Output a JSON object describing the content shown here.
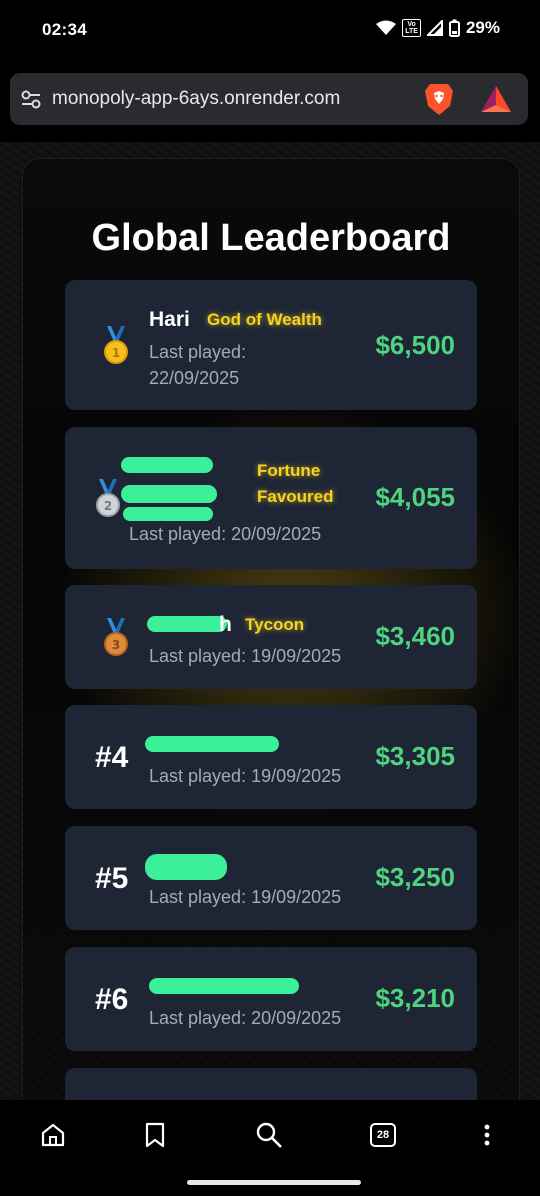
{
  "status": {
    "time": "02:34",
    "battery": "29%"
  },
  "browser": {
    "url": "monopoly-app-6ays.onrender.com"
  },
  "page": {
    "title": "Global Leaderboard"
  },
  "leaderboard": [
    {
      "rank_label": "",
      "medal": "gold-medal-icon",
      "name": "Hari",
      "badge": "God of Wealth",
      "played_label": "Last played:",
      "played_date": "22/09/2025",
      "amount": "$6,500"
    },
    {
      "rank_label": "",
      "medal": "silver-medal-icon",
      "name": "",
      "badge_line1": "Fortune",
      "badge_line2": "Favoured",
      "played": "Last played: 20/09/2025",
      "amount": "$4,055"
    },
    {
      "rank_label": "",
      "medal": "bronze-medal-icon",
      "name": "h",
      "badge": "Tycoon",
      "played": "Last played: 19/09/2025",
      "amount": "$3,460"
    },
    {
      "rank_label": "#4",
      "name": "",
      "played": "Last played: 19/09/2025",
      "amount": "$3,305"
    },
    {
      "rank_label": "#5",
      "name": "",
      "played": "Last played: 19/09/2025",
      "amount": "$3,250"
    },
    {
      "rank_label": "#6",
      "name": "",
      "played": "Last played: 20/09/2025",
      "amount": "$3,210"
    }
  ],
  "nav": {
    "tab_count": "28"
  }
}
